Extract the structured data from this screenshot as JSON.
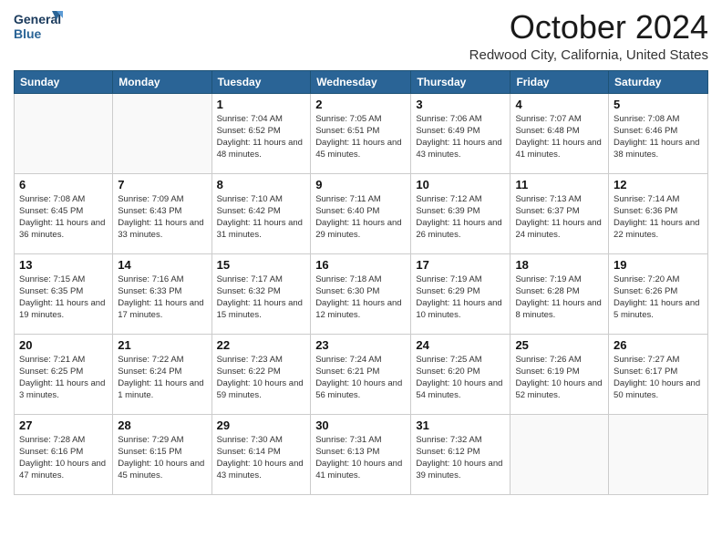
{
  "logo": {
    "line1": "General",
    "line2": "Blue"
  },
  "title": "October 2024",
  "location": "Redwood City, California, United States",
  "days_of_week": [
    "Sunday",
    "Monday",
    "Tuesday",
    "Wednesday",
    "Thursday",
    "Friday",
    "Saturday"
  ],
  "weeks": [
    [
      {
        "day": "",
        "info": ""
      },
      {
        "day": "",
        "info": ""
      },
      {
        "day": "1",
        "info": "Sunrise: 7:04 AM\nSunset: 6:52 PM\nDaylight: 11 hours and 48 minutes."
      },
      {
        "day": "2",
        "info": "Sunrise: 7:05 AM\nSunset: 6:51 PM\nDaylight: 11 hours and 45 minutes."
      },
      {
        "day": "3",
        "info": "Sunrise: 7:06 AM\nSunset: 6:49 PM\nDaylight: 11 hours and 43 minutes."
      },
      {
        "day": "4",
        "info": "Sunrise: 7:07 AM\nSunset: 6:48 PM\nDaylight: 11 hours and 41 minutes."
      },
      {
        "day": "5",
        "info": "Sunrise: 7:08 AM\nSunset: 6:46 PM\nDaylight: 11 hours and 38 minutes."
      }
    ],
    [
      {
        "day": "6",
        "info": "Sunrise: 7:08 AM\nSunset: 6:45 PM\nDaylight: 11 hours and 36 minutes."
      },
      {
        "day": "7",
        "info": "Sunrise: 7:09 AM\nSunset: 6:43 PM\nDaylight: 11 hours and 33 minutes."
      },
      {
        "day": "8",
        "info": "Sunrise: 7:10 AM\nSunset: 6:42 PM\nDaylight: 11 hours and 31 minutes."
      },
      {
        "day": "9",
        "info": "Sunrise: 7:11 AM\nSunset: 6:40 PM\nDaylight: 11 hours and 29 minutes."
      },
      {
        "day": "10",
        "info": "Sunrise: 7:12 AM\nSunset: 6:39 PM\nDaylight: 11 hours and 26 minutes."
      },
      {
        "day": "11",
        "info": "Sunrise: 7:13 AM\nSunset: 6:37 PM\nDaylight: 11 hours and 24 minutes."
      },
      {
        "day": "12",
        "info": "Sunrise: 7:14 AM\nSunset: 6:36 PM\nDaylight: 11 hours and 22 minutes."
      }
    ],
    [
      {
        "day": "13",
        "info": "Sunrise: 7:15 AM\nSunset: 6:35 PM\nDaylight: 11 hours and 19 minutes."
      },
      {
        "day": "14",
        "info": "Sunrise: 7:16 AM\nSunset: 6:33 PM\nDaylight: 11 hours and 17 minutes."
      },
      {
        "day": "15",
        "info": "Sunrise: 7:17 AM\nSunset: 6:32 PM\nDaylight: 11 hours and 15 minutes."
      },
      {
        "day": "16",
        "info": "Sunrise: 7:18 AM\nSunset: 6:30 PM\nDaylight: 11 hours and 12 minutes."
      },
      {
        "day": "17",
        "info": "Sunrise: 7:19 AM\nSunset: 6:29 PM\nDaylight: 11 hours and 10 minutes."
      },
      {
        "day": "18",
        "info": "Sunrise: 7:19 AM\nSunset: 6:28 PM\nDaylight: 11 hours and 8 minutes."
      },
      {
        "day": "19",
        "info": "Sunrise: 7:20 AM\nSunset: 6:26 PM\nDaylight: 11 hours and 5 minutes."
      }
    ],
    [
      {
        "day": "20",
        "info": "Sunrise: 7:21 AM\nSunset: 6:25 PM\nDaylight: 11 hours and 3 minutes."
      },
      {
        "day": "21",
        "info": "Sunrise: 7:22 AM\nSunset: 6:24 PM\nDaylight: 11 hours and 1 minute."
      },
      {
        "day": "22",
        "info": "Sunrise: 7:23 AM\nSunset: 6:22 PM\nDaylight: 10 hours and 59 minutes."
      },
      {
        "day": "23",
        "info": "Sunrise: 7:24 AM\nSunset: 6:21 PM\nDaylight: 10 hours and 56 minutes."
      },
      {
        "day": "24",
        "info": "Sunrise: 7:25 AM\nSunset: 6:20 PM\nDaylight: 10 hours and 54 minutes."
      },
      {
        "day": "25",
        "info": "Sunrise: 7:26 AM\nSunset: 6:19 PM\nDaylight: 10 hours and 52 minutes."
      },
      {
        "day": "26",
        "info": "Sunrise: 7:27 AM\nSunset: 6:17 PM\nDaylight: 10 hours and 50 minutes."
      }
    ],
    [
      {
        "day": "27",
        "info": "Sunrise: 7:28 AM\nSunset: 6:16 PM\nDaylight: 10 hours and 47 minutes."
      },
      {
        "day": "28",
        "info": "Sunrise: 7:29 AM\nSunset: 6:15 PM\nDaylight: 10 hours and 45 minutes."
      },
      {
        "day": "29",
        "info": "Sunrise: 7:30 AM\nSunset: 6:14 PM\nDaylight: 10 hours and 43 minutes."
      },
      {
        "day": "30",
        "info": "Sunrise: 7:31 AM\nSunset: 6:13 PM\nDaylight: 10 hours and 41 minutes."
      },
      {
        "day": "31",
        "info": "Sunrise: 7:32 AM\nSunset: 6:12 PM\nDaylight: 10 hours and 39 minutes."
      },
      {
        "day": "",
        "info": ""
      },
      {
        "day": "",
        "info": ""
      }
    ]
  ]
}
